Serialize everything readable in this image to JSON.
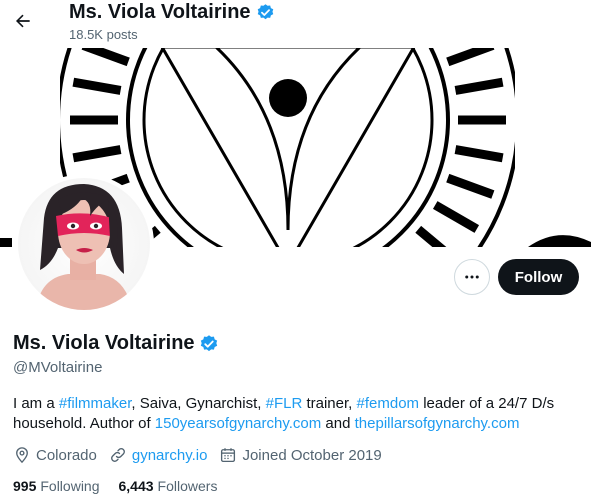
{
  "header": {
    "display_name": "Ms. Viola Voltairine",
    "post_count": "18.5K posts"
  },
  "profile": {
    "display_name": "Ms. Viola Voltairine",
    "handle": "@MVoltairine",
    "follow_label": "Follow",
    "bio": {
      "t1": "I am a ",
      "tag_filmmaker": "#filmmaker",
      "t2": ", Saiva, Gynarchist, ",
      "tag_flr": "#FLR",
      "t3": " trainer, ",
      "tag_femdom": "#femdom",
      "t4": " leader of a 24/7 D/s household. Author of ",
      "link1": "150yearsofgynarchy.com",
      "t5": " and ",
      "link2": "thepillarsofgynarchy.com"
    },
    "location": "Colorado",
    "website": "gynarchy.io",
    "joined": "Joined October 2019",
    "following_count": "995",
    "following_label": "Following",
    "followers_count": "6,443",
    "followers_label": "Followers"
  },
  "icons": [
    "back-arrow-icon",
    "verified-badge-icon",
    "more-icon",
    "location-icon",
    "link-icon",
    "calendar-icon"
  ],
  "colors": {
    "accent": "#1d9bf0",
    "text": "#0f1419",
    "muted": "#536471",
    "button": "#0f1419"
  }
}
